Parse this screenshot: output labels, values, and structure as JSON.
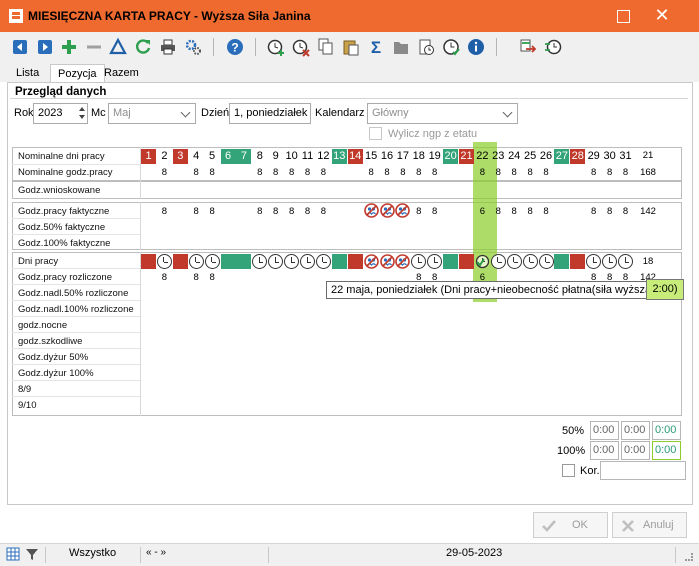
{
  "window": {
    "title": "MIESIĘCZNA KARTA PRACY - Wyższa Siła Janina",
    "maximize_glyph": "☐",
    "close_glyph": "✕"
  },
  "toolbar": {
    "icons": [
      "prev-record-icon",
      "next-record-icon",
      "add-icon",
      "remove-icon",
      "edit-icon",
      "refresh-icon",
      "print-icon",
      "settings-icon",
      "help-icon",
      "add-time-icon",
      "delete-time-icon",
      "copy-icon",
      "paste-icon",
      "sum-icon",
      "folder-icon",
      "calendar-doc-icon",
      "clock-check-icon",
      "info-icon",
      "swap-icon",
      "clock-swap-icon"
    ]
  },
  "tabs": [
    {
      "label": "Lista"
    },
    {
      "label": "Pozycja"
    },
    {
      "label": "Razem"
    }
  ],
  "active_tab": 1,
  "section": {
    "title": "Przegląd danych"
  },
  "filters": {
    "year_label": "Rok",
    "year": "2023",
    "month_label": "Mc",
    "month": "Maj",
    "day_label": "Dzień",
    "day": "1, poniedziałek",
    "calendar_label": "Kalendarz",
    "calendar": "Główny",
    "ngp_label": "Wylicz ngp z etatu"
  },
  "rows": {
    "nominal_days": "Nominalne dni pracy",
    "nominal_hours": "Nominalne godz.pracy",
    "requested": "Godz.wnioskowane",
    "actual": "Godz.pracy faktyczne",
    "actual50": "Godz.50% faktyczne",
    "actual100": "Godz.100% faktyczne",
    "work_days": "Dni pracy",
    "settled": "Godz.pracy rozliczone",
    "ot50": "Godz.nadl.50% rozliczone",
    "ot100": "Godz.nadl.100% rozliczone",
    "night": "godz.nocne",
    "harmful": "godz.szkodliwe",
    "duty50": "Godz.dyżur 50%",
    "duty100": "Godz.dyżur 100%",
    "r89": "8/9",
    "r910": "9/10"
  },
  "calendar": {
    "days": [
      "1",
      "2",
      "3",
      "4",
      "5",
      "6",
      "7",
      "8",
      "9",
      "10",
      "11",
      "12",
      "13",
      "14",
      "15",
      "16",
      "17",
      "18",
      "19",
      "20",
      "21",
      "22",
      "23",
      "24",
      "25",
      "26",
      "27",
      "28",
      "29",
      "30",
      "31"
    ],
    "day_types": [
      "r",
      "n",
      "r",
      "n",
      "n",
      "g",
      "g",
      "n",
      "n",
      "n",
      "n",
      "n",
      "g",
      "r",
      "n",
      "n",
      "n",
      "n",
      "n",
      "g",
      "r",
      "n",
      "n",
      "n",
      "n",
      "n",
      "g",
      "r",
      "n",
      "n",
      "n"
    ],
    "nominal_hours": [
      "",
      "8",
      "",
      "8",
      "8",
      "",
      "",
      "8",
      "8",
      "8",
      "8",
      "8",
      "",
      "",
      "8",
      "8",
      "8",
      "8",
      "8",
      "",
      "",
      "8",
      "8",
      "8",
      "8",
      "8",
      "",
      "",
      "8",
      "8",
      "8"
    ],
    "actual_hours": [
      "",
      "8",
      "",
      "8",
      "8",
      "",
      "",
      "8",
      "8",
      "8",
      "8",
      "8",
      "",
      "",
      "",
      "",
      "",
      "8",
      "8",
      "",
      "",
      "6",
      "8",
      "8",
      "8",
      "8",
      "",
      "",
      "8",
      "8",
      "8"
    ],
    "work_marks": [
      "r",
      "c",
      "r",
      "c",
      "c",
      "g",
      "g",
      "c",
      "c",
      "c",
      "c",
      "c",
      "g",
      "r",
      "s",
      "s",
      "s",
      "c",
      "c",
      "g",
      "r",
      "h",
      "c",
      "c",
      "c",
      "c",
      "g",
      "r",
      "c",
      "c",
      "c"
    ],
    "settled_hours": [
      "",
      "8",
      "",
      "8",
      "8",
      "",
      "",
      "",
      "",
      "",
      "",
      "",
      "",
      "",
      "",
      "",
      "",
      "8",
      "8",
      "",
      "",
      "6",
      "",
      "",
      "",
      "",
      "",
      "",
      "8",
      "8",
      "8"
    ],
    "total_days": "21",
    "total_hours": "168",
    "total_actual": "142",
    "total_work_days": "18",
    "total_settled": "142"
  },
  "tooltip": {
    "text": "22 maja, poniedziałek (Dni pracy+nieobecność płatna(siła wyższa)",
    "highlight": "2:00)"
  },
  "summary": {
    "p50_label": "50%",
    "p50": [
      "0:00",
      "0:00",
      "0:00"
    ],
    "p100_label": "100%",
    "p100": [
      "0:00",
      "0:00",
      "0:00"
    ],
    "kor_label": "Kor."
  },
  "buttons": {
    "ok": "OK",
    "cancel": "Anuluj"
  },
  "status": {
    "filter": "Wszystko",
    "nav": "« - »",
    "date": "29-05-2023"
  },
  "colors": {
    "title_bar": "#ef6a2e",
    "holiday_red": "#c0392b",
    "weekend_green": "#33a37a",
    "highlight": "#8ccd28"
  }
}
